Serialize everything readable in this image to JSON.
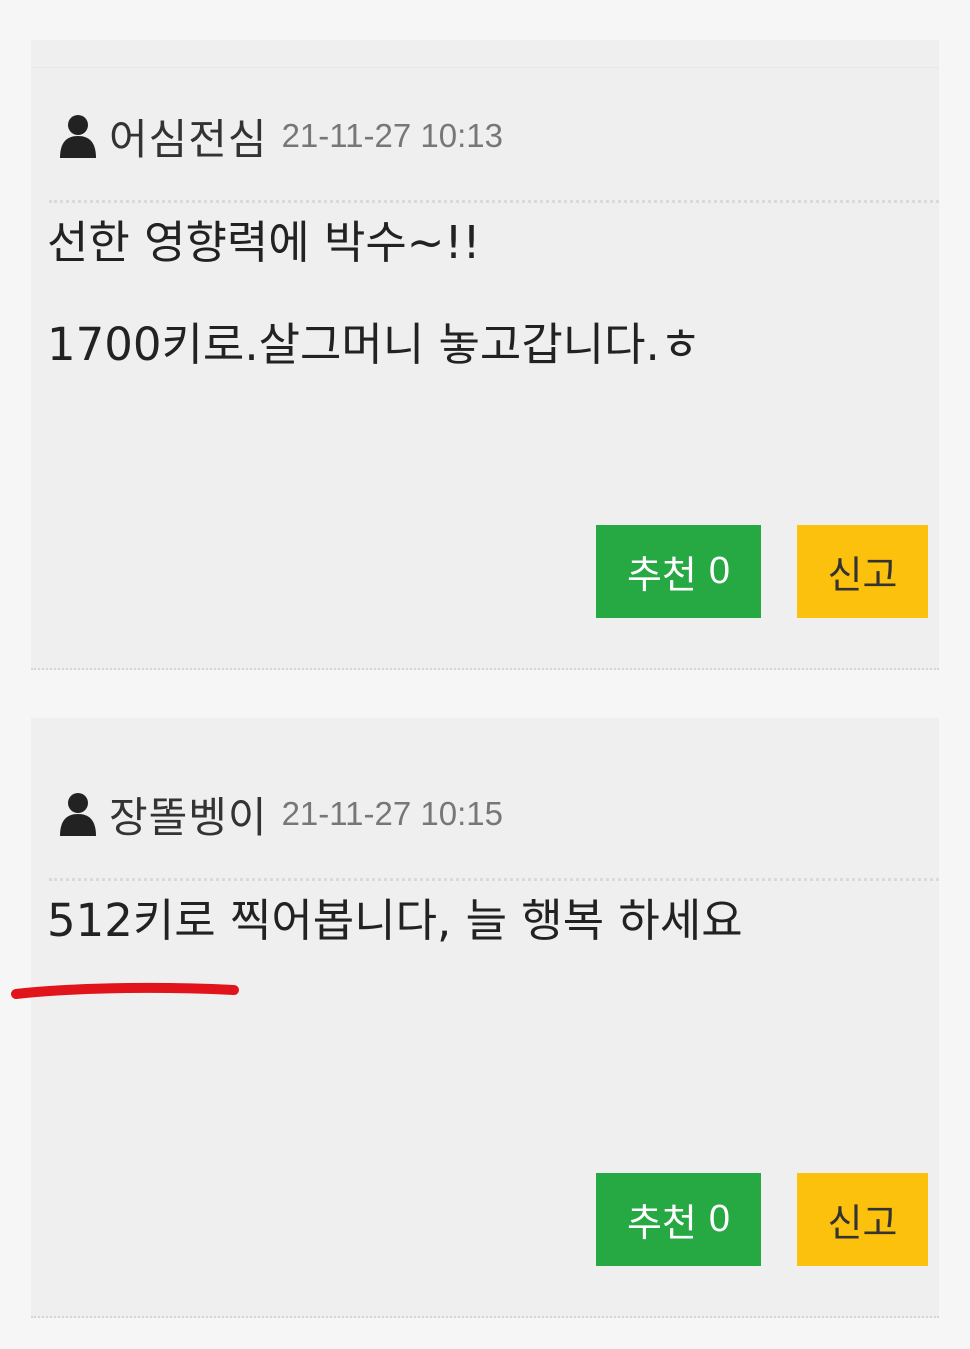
{
  "comments": [
    {
      "author": "어심전심",
      "timestamp": "21-11-27 10:13",
      "lines": [
        "선한 영향력에 박수~!!",
        "1700키로.살그머니 놓고갑니다.ㅎ"
      ],
      "recommend_label": "추천",
      "recommend_count": "0",
      "report_label": "신고"
    },
    {
      "author": "장똘벵이",
      "timestamp": "21-11-27 10:15",
      "lines": [
        "512키로 찍어봅니다, 늘 행복 하세요"
      ],
      "recommend_label": "추천",
      "recommend_count": "0",
      "report_label": "신고"
    }
  ],
  "colors": {
    "recommend": "#26a843",
    "report": "#fcc10d",
    "annotation": "#e0141a"
  },
  "icons": {
    "author": "user-icon"
  }
}
